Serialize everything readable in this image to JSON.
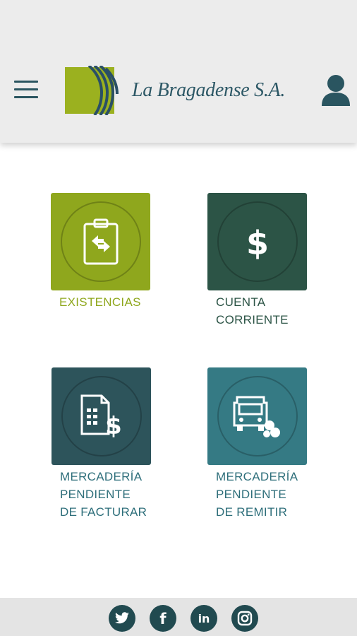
{
  "header": {
    "brand_name": "La Bragadense S.A.",
    "menu_icon": "hamburger-menu-icon",
    "user_icon": "user-icon"
  },
  "tiles": [
    {
      "label": "EXISTENCIAS",
      "icon": "clipboard-exchange-icon",
      "bg": "#8fa71d",
      "text_color": "#8fa71d"
    },
    {
      "label": "CUENTA\nCORRIENTE",
      "icon": "dollar-icon",
      "bg": "#2c5446",
      "text_color": "#2c5446"
    },
    {
      "label": "MERCADERÍA\nPENDIENTE\nDE FACTURAR",
      "icon": "invoice-dollar-icon",
      "bg": "#2d545b",
      "text_color": "#2d6e7a"
    },
    {
      "label": "MERCADERÍA\nPENDIENTE\nDE REMITIR",
      "icon": "truck-icon",
      "bg": "#357a84",
      "text_color": "#2d6e7a"
    }
  ],
  "footer": {
    "social": [
      "twitter-icon",
      "facebook-icon",
      "linkedin-icon",
      "instagram-icon"
    ],
    "facebook_glyph": "f",
    "linkedin_glyph": "in"
  },
  "colors": {
    "brand_dark": "#2d5866",
    "brand_green": "#8fa71d"
  }
}
